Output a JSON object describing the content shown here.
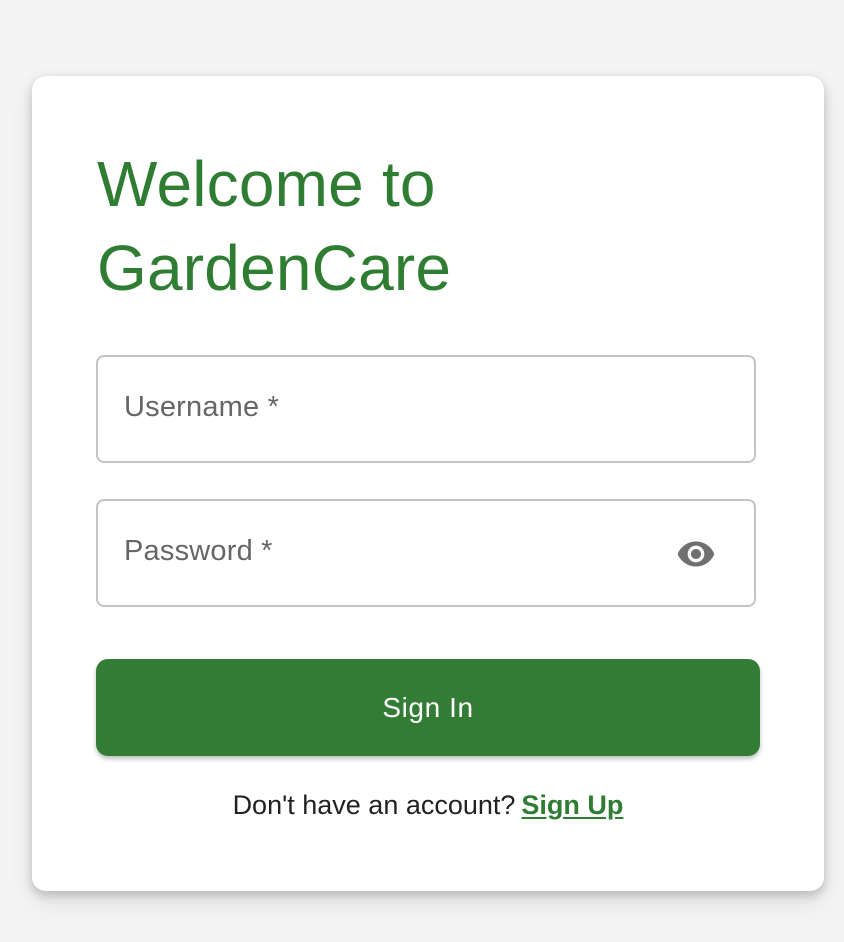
{
  "page": {
    "background_color": "#f4f4f4",
    "accent_color": "#2e7d32"
  },
  "login": {
    "title": "Welcome to GardenCare",
    "username_label": "Username *",
    "password_label": "Password *",
    "password_visibility_icon": "eye-icon",
    "sign_in_label": "Sign In",
    "signup_prompt": "Don't have an account?",
    "signup_link_label": "Sign Up"
  }
}
